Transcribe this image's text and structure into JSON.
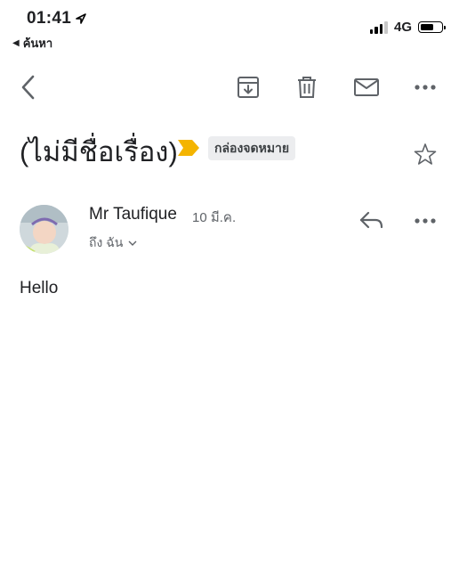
{
  "status_bar": {
    "time": "01:41",
    "back_app": "ค้นหา",
    "network": "4G",
    "battery_level": 0.7
  },
  "subject": "(ไม่มีชื่อเรื่อง)",
  "label": "กล่องจดหมาย",
  "message": {
    "sender_name": "Mr Taufique",
    "date": "10 มี.ค.",
    "recipients": "ถึง ฉัน",
    "body": "Hello"
  },
  "colors": {
    "importance": "#f4b400",
    "icon": "#5f6368",
    "chip_bg": "#ecedef"
  },
  "icons": [
    "location-arrow-icon",
    "back-arrow-icon",
    "archive-icon",
    "delete-icon",
    "mark-unread-icon",
    "more-vert-icon",
    "importance-marker-icon",
    "star-icon",
    "reply-icon",
    "chevron-down-icon"
  ]
}
